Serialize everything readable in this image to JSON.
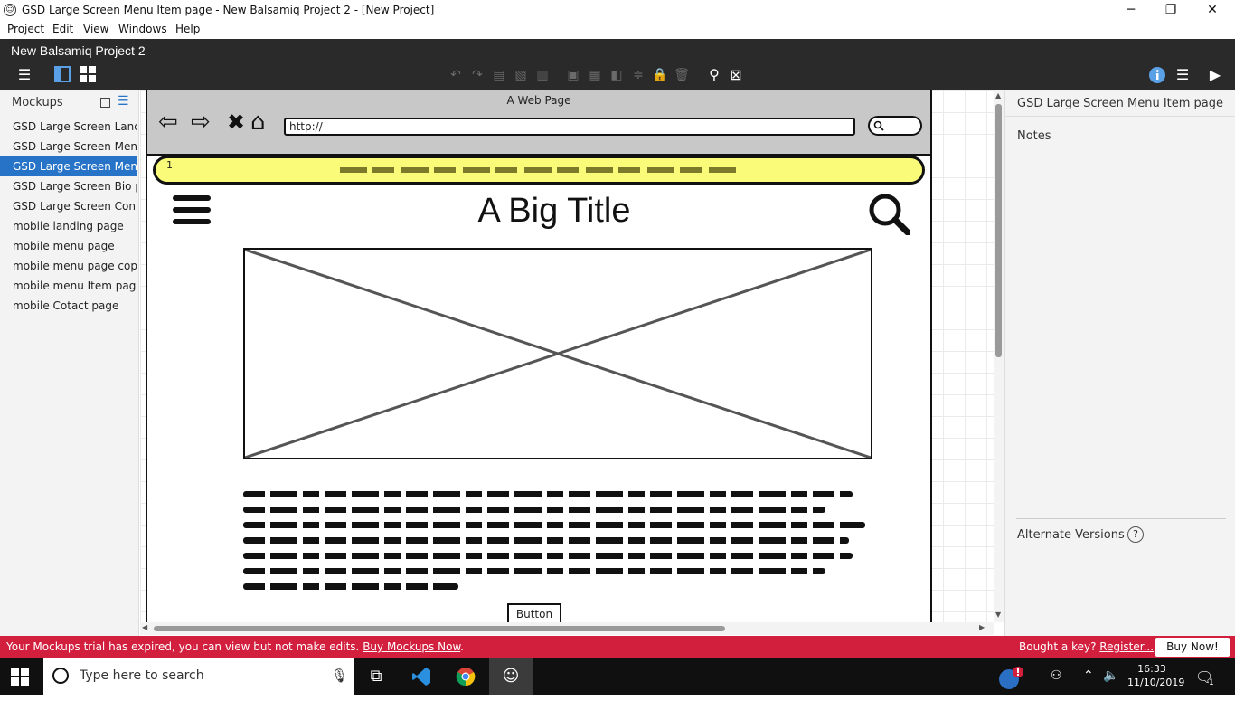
{
  "window": {
    "title": "GSD Large Screen Menu Item page - New Balsamiq Project 2 - [New Project]",
    "minimize": "─",
    "restore": "❐",
    "close": "✕"
  },
  "menubar": [
    "Project",
    "Edit",
    "View",
    "Windows",
    "Help"
  ],
  "app": {
    "project_title": "New Balsamiq Project 2"
  },
  "left_panel": {
    "header": "Mockups",
    "items": [
      {
        "label": "GSD Large Screen Landi",
        "selected": false
      },
      {
        "label": "GSD Large Screen Menu",
        "selected": false
      },
      {
        "label": "GSD Large Screen Menu",
        "selected": true
      },
      {
        "label": "GSD Large Screen Bio pa",
        "selected": false
      },
      {
        "label": "GSD Large Screen Conta",
        "selected": false
      },
      {
        "label": "mobile landing page",
        "selected": false
      },
      {
        "label": "mobile menu page",
        "selected": false
      },
      {
        "label": "mobile menu page copy",
        "selected": false
      },
      {
        "label": "mobile menu Item page",
        "selected": false
      },
      {
        "label": "mobile Cotact page",
        "selected": false
      }
    ]
  },
  "mockup": {
    "browser_title": "A Web Page",
    "url": "http://",
    "banner_number": "1",
    "big_title": "A Big Title",
    "button_label": "Button"
  },
  "right_panel": {
    "title": "GSD Large Screen Menu Item page",
    "notes_label": "Notes",
    "alternate_versions_label": "Alternate Versions",
    "help_glyph": "?"
  },
  "trial_bar": {
    "message": "Your Mockups trial has expired, you can view but not make edits. ",
    "buy_link": "Buy Mockups Now",
    "buy_link_suffix": ".",
    "key_prompt": "Bought a key? ",
    "register_link": "Register...",
    "buy_now": "Buy Now!"
  },
  "taskbar": {
    "search_placeholder": "Type here to search",
    "time": "16:33",
    "date": "11/10/2019",
    "notification_count": "1"
  },
  "colors": {
    "selection": "#2673c8",
    "trial_bar": "#d31f3e",
    "banner": "#fbfb7a",
    "header_dark": "#2a2a2a"
  }
}
